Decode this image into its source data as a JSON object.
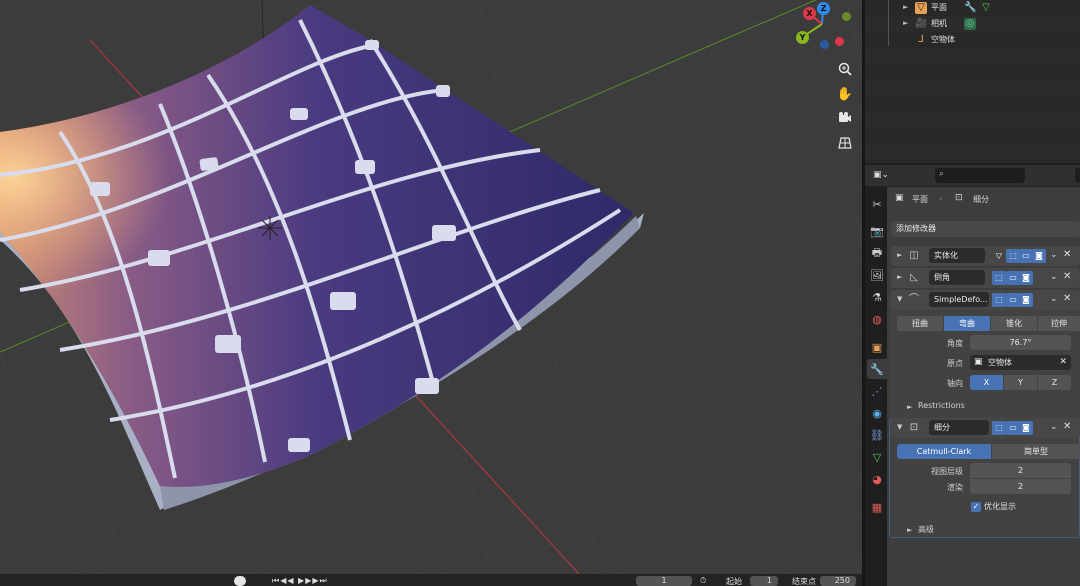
{
  "outliner": {
    "items": [
      {
        "label": "平面",
        "icon": "mesh-icon",
        "arrow": "►"
      },
      {
        "label": "相机",
        "icon": "camera-icon",
        "arrow": "►"
      },
      {
        "label": "空物体",
        "icon": "empty-icon",
        "arrow": ""
      }
    ]
  },
  "properties": {
    "search_placeholder": "",
    "breadcrumb": {
      "object": "平面",
      "sep": "›",
      "modifier": "细分"
    },
    "add_modifier_label": "添加修改器",
    "modifiers": {
      "solidify": {
        "name": "实体化"
      },
      "bevel": {
        "name": "倒角"
      },
      "simple_deform": {
        "name": "SimpleDefo...",
        "modes": [
          "扭曲",
          "弯曲",
          "锥化",
          "拉伸"
        ],
        "active_mode": "弯曲",
        "angle_label": "角度",
        "angle_value": "76.7°",
        "origin_label": "原点",
        "origin_value": "空物体",
        "axis_label": "轴向",
        "axes": [
          "X",
          "Y",
          "Z"
        ],
        "active_axis": "X",
        "restrictions_label": "Restrictions"
      },
      "subdivision": {
        "name": "细分",
        "types": [
          "Catmull-Clark",
          "简单型"
        ],
        "active_type": "Catmull-Clark",
        "viewport_levels_label": "视图层级",
        "viewport_levels_value": "2",
        "render_label": "渲染",
        "render_value": "2",
        "optimal_display_label": "优化显示",
        "advanced_label": "高级"
      }
    }
  },
  "gizmo": {
    "x": "X",
    "y": "Y",
    "z": "Z"
  },
  "timeline": {
    "current_frame": "1",
    "start_label": "起始",
    "start_value": "1",
    "end_label": "结束点",
    "end_value": "250"
  },
  "colors": {
    "accent": "#4772b3",
    "axis_x": "#e0364a",
    "axis_y": "#8ab51e",
    "axis_z": "#2d8ceb",
    "viewport_bg": "#3c3c3c"
  }
}
